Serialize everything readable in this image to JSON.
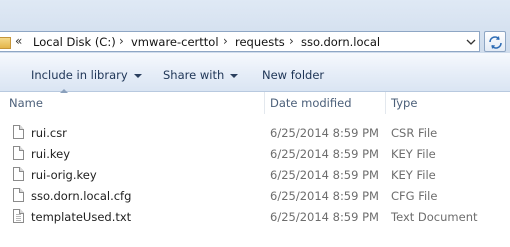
{
  "address_bar": {
    "overflow_glyph": "«",
    "separator_glyph": "›",
    "crumbs": [
      "Local Disk (C:)",
      "vmware-certtol",
      "requests",
      "sso.dorn.local"
    ],
    "dropdown_icon": "chevron-down-icon",
    "refresh_icon": "refresh-icon"
  },
  "toolbar": {
    "include_in_library": "Include in library",
    "share_with": "Share with",
    "new_folder": "New folder"
  },
  "columns": {
    "name": "Name",
    "date_modified": "Date modified",
    "type": "Type"
  },
  "files": [
    {
      "name": "rui.csr",
      "date": "6/25/2014 8:59 PM",
      "type": "CSR File",
      "icon": "document-icon"
    },
    {
      "name": "rui.key",
      "date": "6/25/2014 8:59 PM",
      "type": "KEY File",
      "icon": "document-icon"
    },
    {
      "name": "rui-orig.key",
      "date": "6/25/2014 8:59 PM",
      "type": "KEY File",
      "icon": "document-icon"
    },
    {
      "name": "sso.dorn.local.cfg",
      "date": "6/25/2014 8:59 PM",
      "type": "CFG File",
      "icon": "document-icon"
    },
    {
      "name": "templateUsed.txt",
      "date": "6/25/2014 8:59 PM",
      "type": "Text Document",
      "icon": "text-document-icon"
    }
  ]
}
